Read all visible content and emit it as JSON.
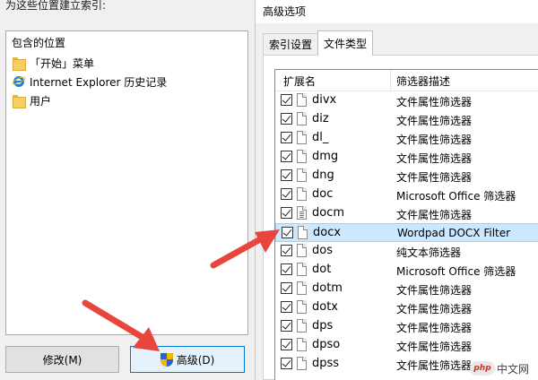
{
  "indexing": {
    "header": "为这些位置建立索引:",
    "panel_title": "包含的位置",
    "locations": [
      {
        "label": "「开始」菜单",
        "icon": "folder-icon"
      },
      {
        "label": "Internet Explorer 历史记录",
        "icon": "internet-explorer-icon"
      },
      {
        "label": "用户",
        "icon": "folder-icon"
      }
    ],
    "modify_button": "修改(M)",
    "advanced_button": "高级(D)"
  },
  "advanced_dialog": {
    "title": "高级选项",
    "tabs": [
      {
        "label": "索引设置",
        "active": false
      },
      {
        "label": "文件类型",
        "active": true
      }
    ],
    "columns": {
      "extension": "扩展名",
      "filter": "筛选器描述"
    },
    "rows": [
      {
        "ext": "divx",
        "desc": "文件属性筛选器",
        "checked": true,
        "selected": false,
        "icon": "blank-file-icon"
      },
      {
        "ext": "diz",
        "desc": "文件属性筛选器",
        "checked": true,
        "selected": false,
        "icon": "blank-file-icon"
      },
      {
        "ext": "dl_",
        "desc": "文件属性筛选器",
        "checked": true,
        "selected": false,
        "icon": "blank-file-icon"
      },
      {
        "ext": "dmg",
        "desc": "文件属性筛选器",
        "checked": true,
        "selected": false,
        "icon": "blank-file-icon"
      },
      {
        "ext": "dng",
        "desc": "文件属性筛选器",
        "checked": true,
        "selected": false,
        "icon": "blank-file-icon"
      },
      {
        "ext": "doc",
        "desc": "Microsoft Office 筛选器",
        "checked": true,
        "selected": false,
        "icon": "blank-file-icon"
      },
      {
        "ext": "docm",
        "desc": "文件属性筛选器",
        "checked": true,
        "selected": false,
        "icon": "text-file-icon"
      },
      {
        "ext": "docx",
        "desc": "Wordpad DOCX Filter",
        "checked": true,
        "selected": true,
        "icon": "blank-file-icon"
      },
      {
        "ext": "dos",
        "desc": "纯文本筛选器",
        "checked": true,
        "selected": false,
        "icon": "blank-file-icon"
      },
      {
        "ext": "dot",
        "desc": "Microsoft Office 筛选器",
        "checked": true,
        "selected": false,
        "icon": "blank-file-icon"
      },
      {
        "ext": "dotm",
        "desc": "文件属性筛选器",
        "checked": true,
        "selected": false,
        "icon": "blank-file-icon"
      },
      {
        "ext": "dotx",
        "desc": "文件属性筛选器",
        "checked": true,
        "selected": false,
        "icon": "blank-file-icon"
      },
      {
        "ext": "dps",
        "desc": "文件属性筛选器",
        "checked": true,
        "selected": false,
        "icon": "blank-file-icon"
      },
      {
        "ext": "dpso",
        "desc": "文件属性筛选器",
        "checked": true,
        "selected": false,
        "icon": "blank-file-icon"
      },
      {
        "ext": "dpss",
        "desc": "文件属性筛选器",
        "checked": true,
        "selected": false,
        "icon": "blank-file-icon"
      }
    ]
  },
  "watermark": {
    "text": "中文网"
  },
  "colors": {
    "annotation_arrow": "#e8453c",
    "selection": "#cce8ff",
    "accent": "#0078d7"
  }
}
